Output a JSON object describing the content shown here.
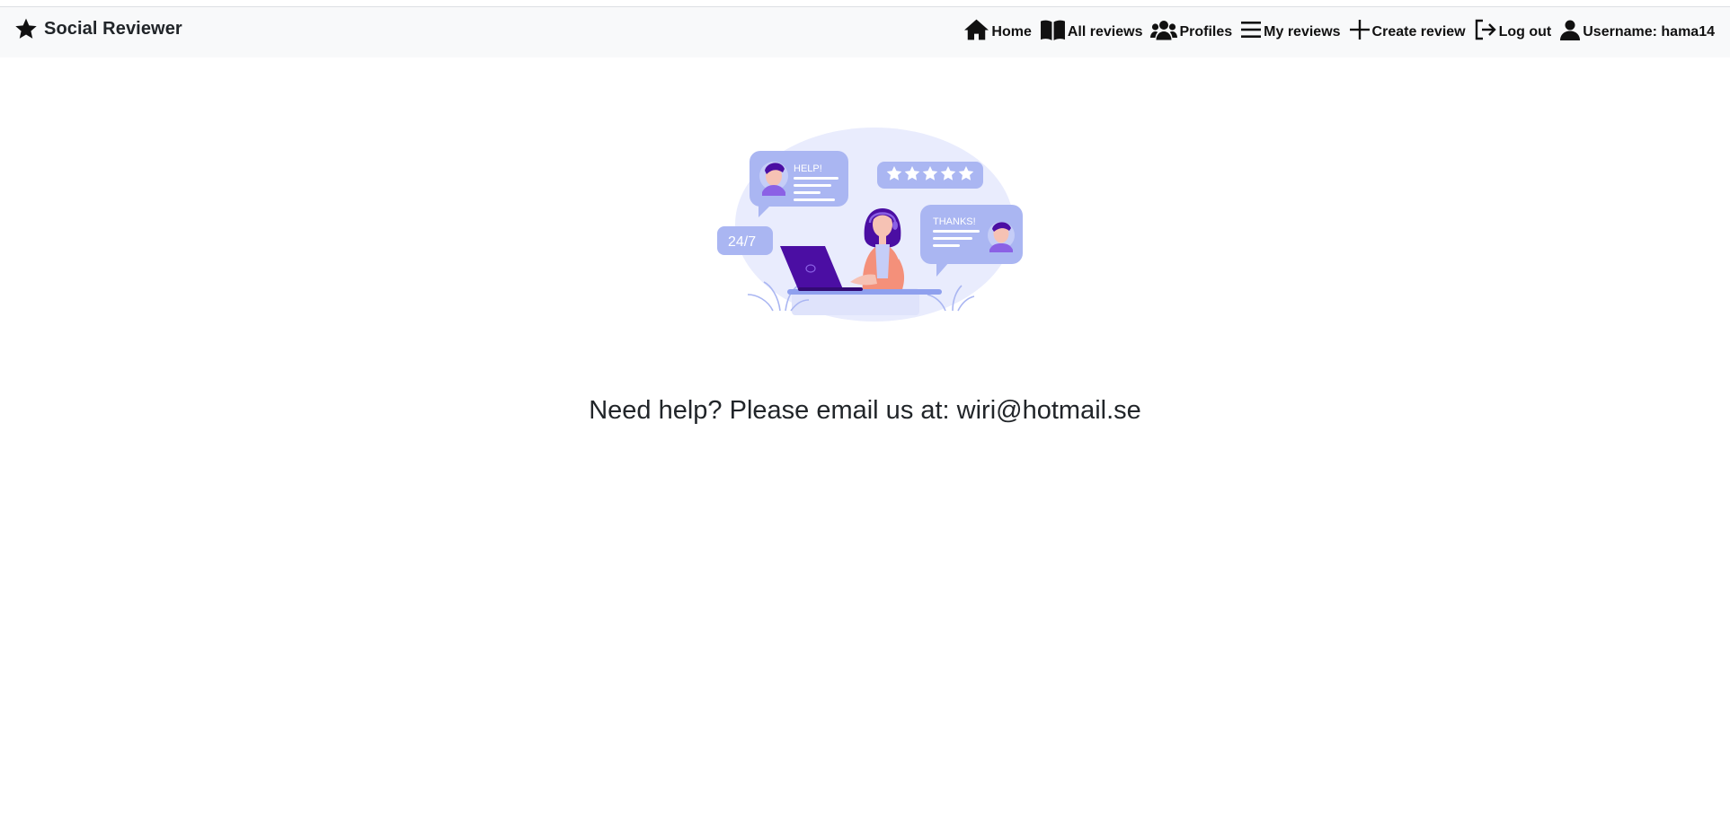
{
  "navbar": {
    "brand": {
      "label": "Social Reviewer",
      "icon": "star-icon"
    },
    "links": [
      {
        "label": "Home",
        "icon": "home-icon"
      },
      {
        "label": "All reviews",
        "icon": "book-icon"
      },
      {
        "label": "Profiles",
        "icon": "users-icon"
      },
      {
        "label": "My reviews",
        "icon": "list-icon"
      },
      {
        "label": "Create review",
        "icon": "plus-icon"
      },
      {
        "label": "Log out",
        "icon": "logout-icon"
      },
      {
        "label": "Username: hama14",
        "icon": "user-icon"
      }
    ],
    "background": "#f8f9fa"
  },
  "illustration": {
    "icon": "customer-support-illustration",
    "bubble_texts": [
      "HELP!",
      "THANKS!",
      "24/7"
    ],
    "stars": 5,
    "colors": {
      "primary": "#4b0ea3",
      "bubble": "#aab6f2",
      "halo": "#e9ecfd",
      "skin": "#f4907a"
    }
  },
  "main": {
    "help_text": "Need help? Please email us at: wiri@hotmail.se"
  }
}
